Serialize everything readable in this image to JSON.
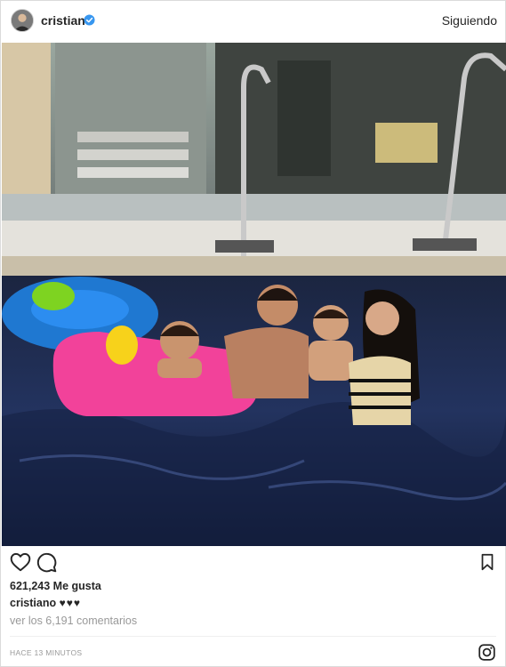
{
  "header": {
    "username": "cristiano",
    "verified_icon": "verified-badge-icon",
    "follow_status": "Siguiendo"
  },
  "post": {
    "likes": "621,243 Me gusta",
    "caption_user": "cristiano",
    "caption_text": "♥♥♥",
    "comments_link": "ver los 6,191 comentarios",
    "timestamp": "HACE 13 MINUTOS"
  },
  "icons": {
    "like": "heart-icon",
    "comment": "comment-icon",
    "save": "bookmark-icon",
    "brand": "instagram-icon"
  },
  "colors": {
    "text": "#262626",
    "muted": "#999999",
    "verified": "#3897f0",
    "border": "#dbdbdb"
  }
}
